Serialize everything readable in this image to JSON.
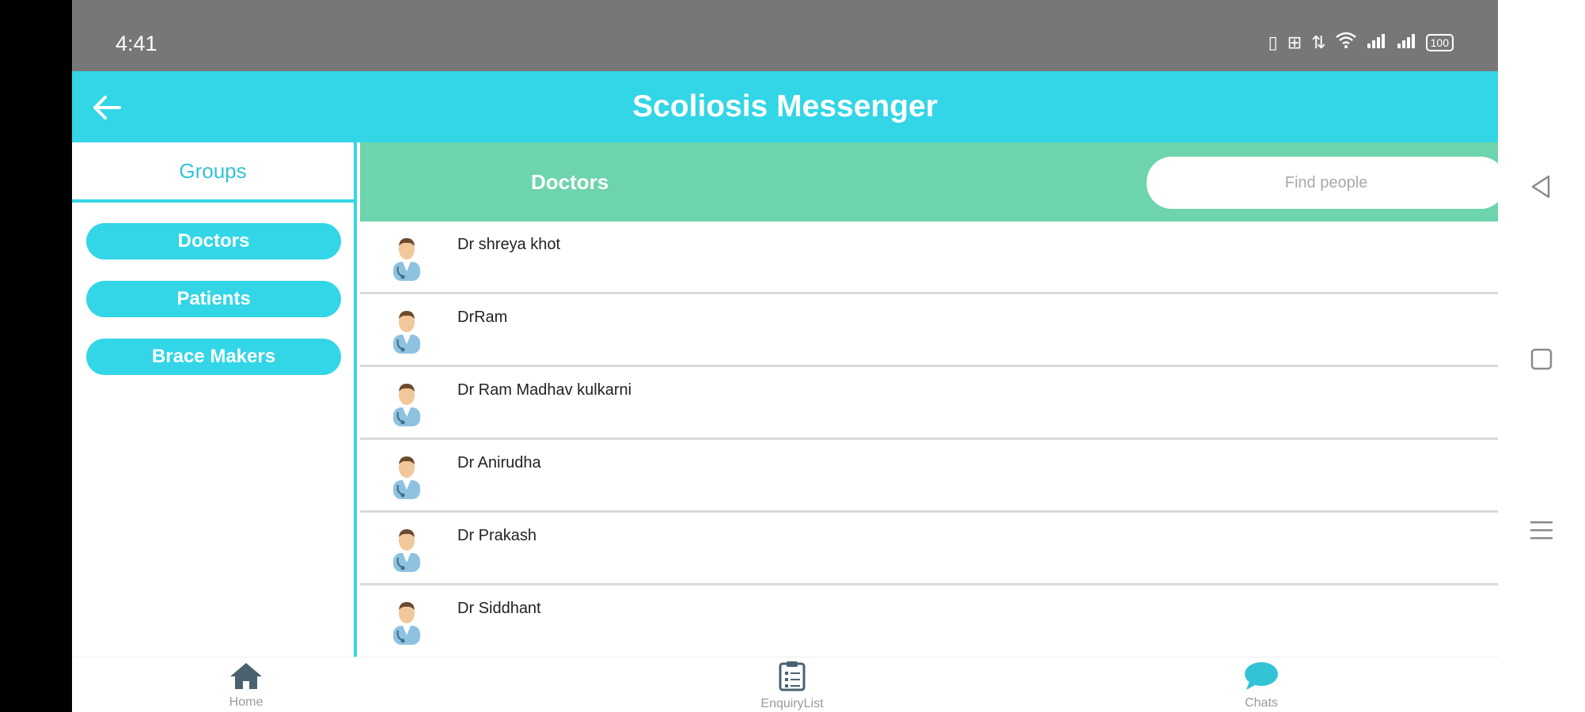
{
  "status_bar": {
    "time": "4:41",
    "battery": "100"
  },
  "header": {
    "title": "Scoliosis Messenger"
  },
  "groups": {
    "tab_label": "Groups",
    "items": [
      {
        "label": "Doctors"
      },
      {
        "label": "Patients"
      },
      {
        "label": "Brace Makers"
      }
    ]
  },
  "doctors_bar": {
    "label": "Doctors",
    "search_placeholder": "Find people"
  },
  "doctors": [
    {
      "name": "Dr shreya khot"
    },
    {
      "name": "DrRam"
    },
    {
      "name": "Dr Ram Madhav kulkarni"
    },
    {
      "name": "Dr Anirudha"
    },
    {
      "name": "Dr Prakash"
    },
    {
      "name": "Dr Siddhant"
    }
  ],
  "bottom_nav": {
    "items": [
      {
        "label": "Home",
        "icon": "home-icon"
      },
      {
        "label": "EnquiryList",
        "icon": "clipboard-icon"
      },
      {
        "label": "Chats",
        "icon": "chat-bubble-icon"
      }
    ]
  },
  "colors": {
    "header": "#33d6e6",
    "doctors_bar": "#6dd4ad",
    "status_bar": "#777777",
    "chats_active": "#33c3d6"
  }
}
